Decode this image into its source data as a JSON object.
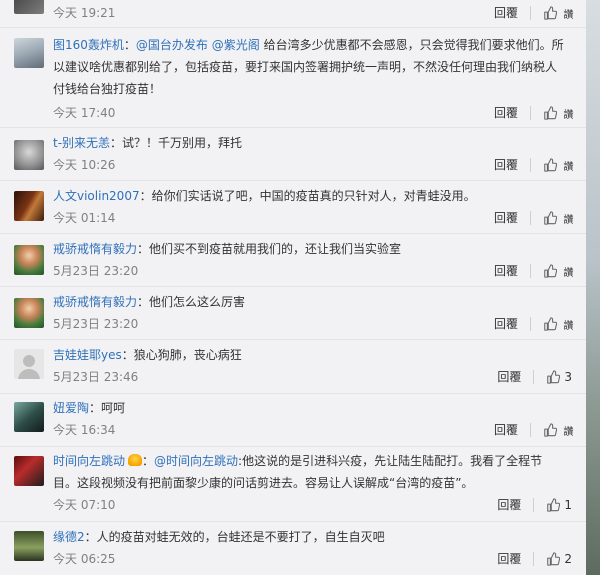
{
  "reply_label": "回覆",
  "like_text": "讚",
  "colors": {
    "name": "#2f70b9",
    "meta": "#808080",
    "text": "#333333"
  },
  "comments": [
    {
      "user": "",
      "text": "",
      "time": "今天 19:21",
      "likes": "讚"
    },
    {
      "user": "图160轰炸机",
      "mention_prefix": "：",
      "mentions": [
        "@国台办发布",
        "@紫光阁"
      ],
      "text": "给台湾多少优惠都不会感恩，只会觉得我们要求他们。所以建议啥优惠都别给了，包括疫苗，要打来国内签署拥护统一声明，不然没任何理由我们纳税人付钱给台独打疫苗！",
      "time": "今天 17:40",
      "likes": "讚"
    },
    {
      "user": "t-别来无恙",
      "text": "：试？！千万别用，拜托",
      "time": "今天 10:26",
      "likes": "讚"
    },
    {
      "user": "人文violin2007",
      "text": "：给你们实话说了吧，中国的疫苗真的只针对人，对青蛙没用。",
      "time": "今天 01:14",
      "likes": "讚"
    },
    {
      "user": "戒骄戒惰有毅力",
      "text": "：他们买不到疫苗就用我们的，还让我们当实验室",
      "time": "5月23日 23:20",
      "likes": "讚"
    },
    {
      "user": "戒骄戒惰有毅力",
      "text": "：他们怎么这么厉害",
      "time": "5月23日 23:20",
      "likes": "讚"
    },
    {
      "user": "吉娃娃耶yes",
      "text": "：狼心狗肺，丧心病狂",
      "time": "5月23日 23:46",
      "likes": "3"
    },
    {
      "user": "妞爱陶",
      "text": "：呵呵",
      "time": "今天 16:34",
      "likes": "讚"
    },
    {
      "user": "时间向左跳动",
      "mention_prefix": "：",
      "mentions": [
        "@时间向左跳动"
      ],
      "text": ":他这说的是引进科兴疫，先让陆生陆配打。我看了全程节目。这段视频没有把前面黎少康的问话剪进去。容易让人误解成“台湾的疫苗”。",
      "time": "今天 07:10",
      "likes": "1"
    },
    {
      "user": "缘德2",
      "text": "：人的疫苗对蛙无效的，台蛙还是不要打了，自生自灭吧",
      "time": "今天 06:25",
      "likes": "2"
    }
  ]
}
